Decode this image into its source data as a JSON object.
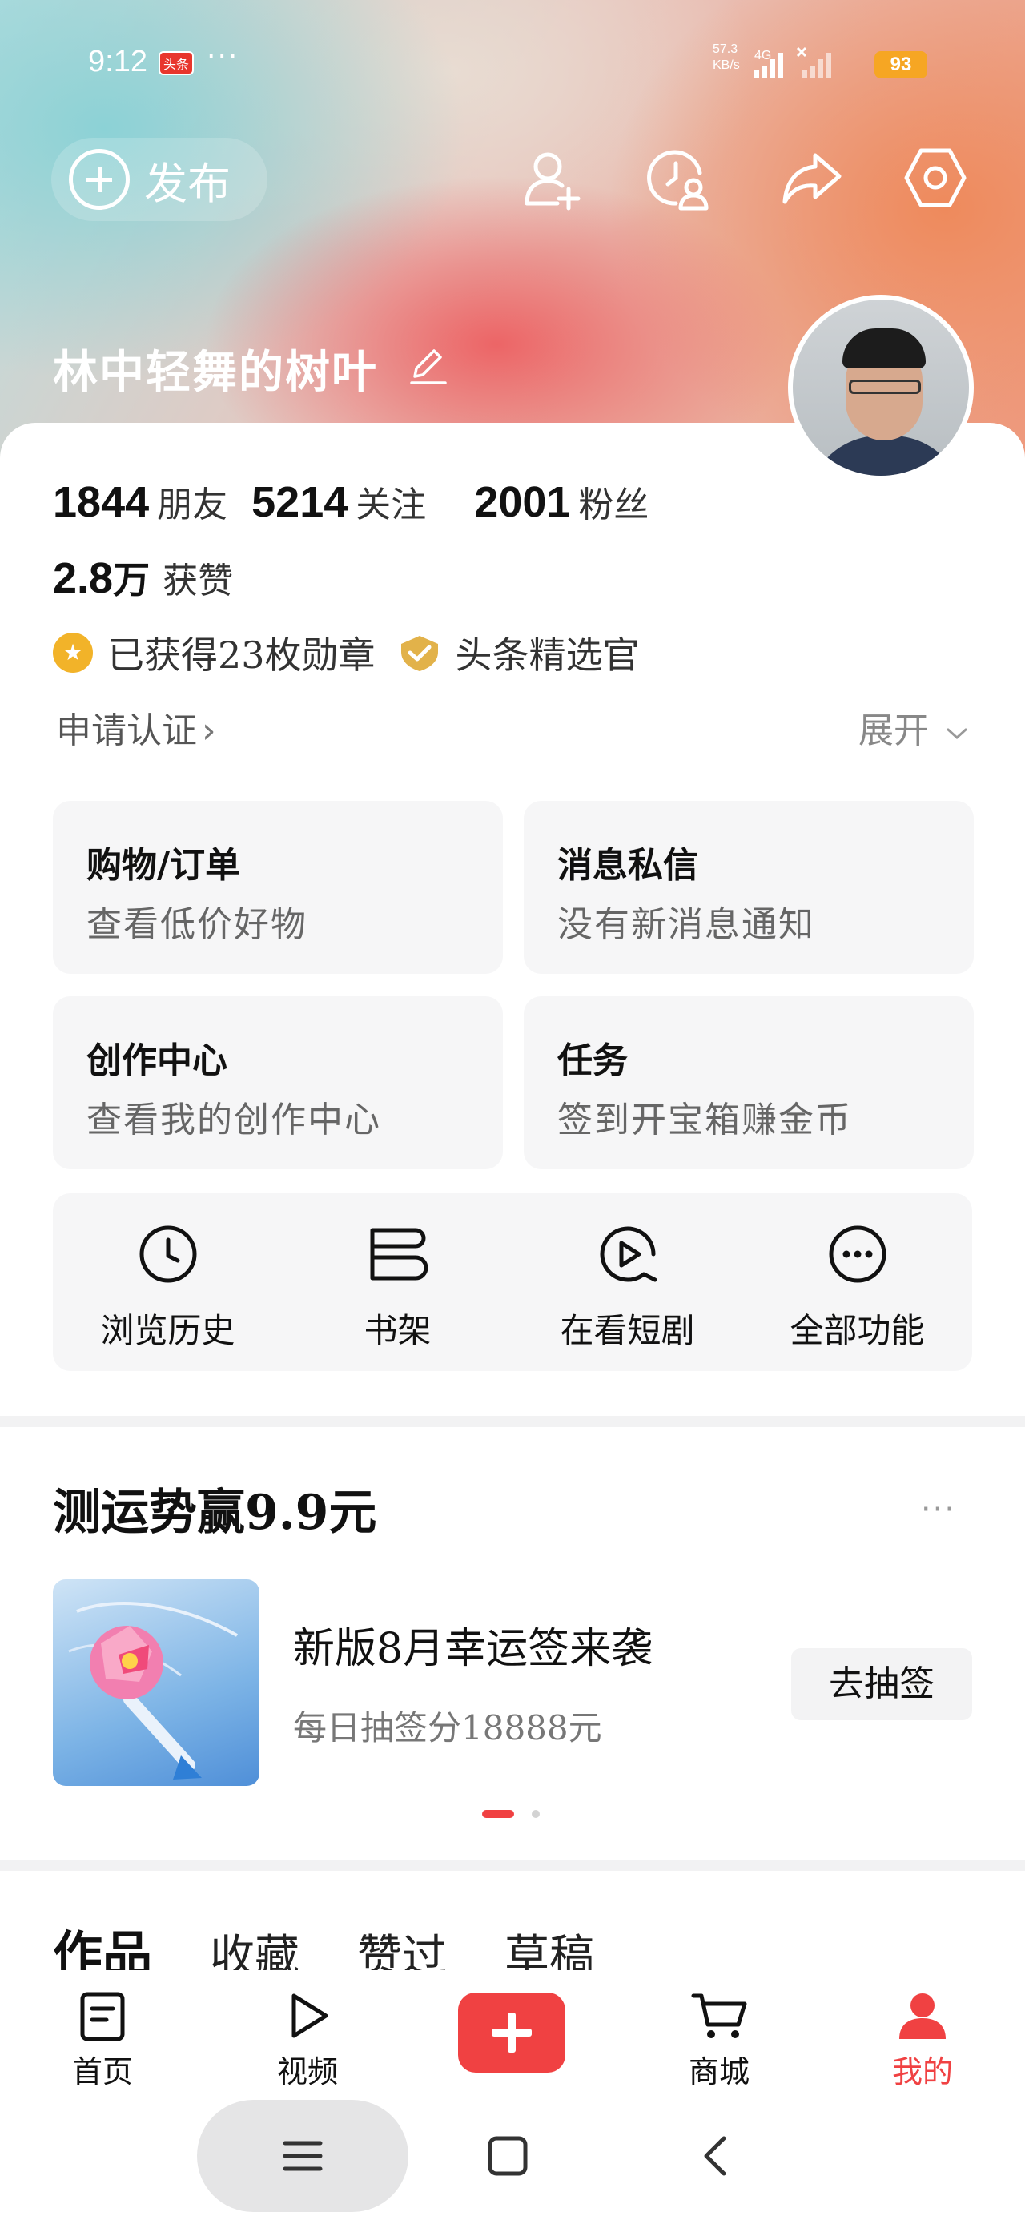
{
  "status_bar": {
    "time": "9:12",
    "app_badge": "头条",
    "more": "···",
    "speed_value": "57.3",
    "speed_unit": "KB/s",
    "network": "4G",
    "battery": "93"
  },
  "header": {
    "publish_label": "发布",
    "username": "林中轻舞的树叶"
  },
  "stats": {
    "friends_count": "1844",
    "friends_label": "朋友",
    "following_count": "5214",
    "following_label": "关注",
    "fans_count": "2001",
    "fans_label": "粉丝",
    "likes_count": "2.8",
    "likes_unit": "万",
    "likes_label": "获赞"
  },
  "badges": {
    "medals": "已获得23枚勋章",
    "selected": "头条精选官"
  },
  "verify": {
    "apply": "申请认证",
    "chevron": "›",
    "expand": "展开"
  },
  "tiles": [
    {
      "title": "购物/订单",
      "subtitle": "查看低价好物"
    },
    {
      "title": "消息私信",
      "subtitle": "没有新消息通知"
    },
    {
      "title": "创作中心",
      "subtitle": "查看我的创作中心"
    },
    {
      "title": "任务",
      "subtitle": "签到开宝箱赚金币"
    }
  ],
  "quick": [
    {
      "label": "浏览历史",
      "icon": "clock-icon"
    },
    {
      "label": "书架",
      "icon": "bookshelf-icon"
    },
    {
      "label": "在看短剧",
      "icon": "play-circle-icon"
    },
    {
      "label": "全部功能",
      "icon": "more-circle-icon"
    }
  ],
  "promo": {
    "title": "测运势赢9.9元",
    "more": "···",
    "headline": "新版8月幸运签来袭",
    "sub": "每日抽签分18888元",
    "button": "去抽签"
  },
  "content_tabs": [
    "作品",
    "收藏",
    "赞过",
    "草稿"
  ],
  "bottom_nav": [
    {
      "label": "首页",
      "icon": "home-doc-icon"
    },
    {
      "label": "视频",
      "icon": "play-icon"
    },
    {
      "label": "商城",
      "icon": "cart-icon"
    },
    {
      "label": "我的",
      "icon": "person-icon"
    }
  ],
  "colors": {
    "accent": "#f04142",
    "battery": "#f6a623",
    "medal": "#f2b329"
  }
}
